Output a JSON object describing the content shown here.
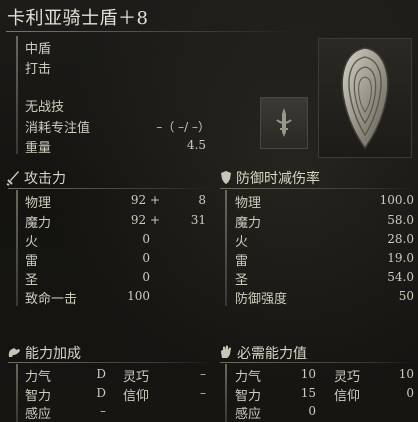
{
  "title": "卡利亚骑士盾＋8",
  "info": {
    "type": "中盾",
    "attack_type": "打击",
    "skill": "无战技",
    "fp_cost_label": "消耗专注值",
    "fp_cost_value": "–（  –/  –）",
    "weight_label": "重量",
    "weight_value": "4.5"
  },
  "attack": {
    "header": "攻击力",
    "rows": [
      {
        "label": "物理",
        "base": "92 +",
        "bonus": "8"
      },
      {
        "label": "魔力",
        "base": "92 +",
        "bonus": "31"
      },
      {
        "label": "火",
        "base": "0",
        "bonus": ""
      },
      {
        "label": "雷",
        "base": "0",
        "bonus": ""
      },
      {
        "label": "圣",
        "base": "0",
        "bonus": ""
      },
      {
        "label": "致命一击",
        "base": "100",
        "bonus": ""
      }
    ]
  },
  "defense": {
    "header": "防御时减伤率",
    "rows": [
      {
        "label": "物理",
        "value": "100.0"
      },
      {
        "label": "魔力",
        "value": "58.0"
      },
      {
        "label": "火",
        "value": "28.0"
      },
      {
        "label": "雷",
        "value": "19.0"
      },
      {
        "label": "圣",
        "value": "54.0"
      },
      {
        "label": "防御强度",
        "value": "50"
      }
    ]
  },
  "scaling": {
    "header": "能力加成",
    "rows": [
      {
        "a_label": "力气",
        "a_value": "D",
        "b_label": "灵巧",
        "b_value": "–"
      },
      {
        "a_label": "智力",
        "a_value": "D",
        "b_label": "信仰",
        "b_value": "–"
      },
      {
        "a_label": "感应",
        "a_value": "–",
        "b_label": "",
        "b_value": ""
      }
    ]
  },
  "requirements": {
    "header": "必需能力值",
    "rows": [
      {
        "a_label": "力气",
        "a_value": "10",
        "b_label": "灵巧",
        "b_value": "10"
      },
      {
        "a_label": "智力",
        "a_value": "15",
        "b_label": "信仰",
        "b_value": "0"
      },
      {
        "a_label": "感应",
        "a_value": "0",
        "b_label": "",
        "b_value": ""
      }
    ]
  },
  "icons": {
    "attack": "sword-icon",
    "defense": "shield-icon",
    "scaling": "arm-flex-icon",
    "requirements": "hand-icon",
    "skill_slot": "sword-crest-icon",
    "portrait": "heater-shield-icon"
  }
}
